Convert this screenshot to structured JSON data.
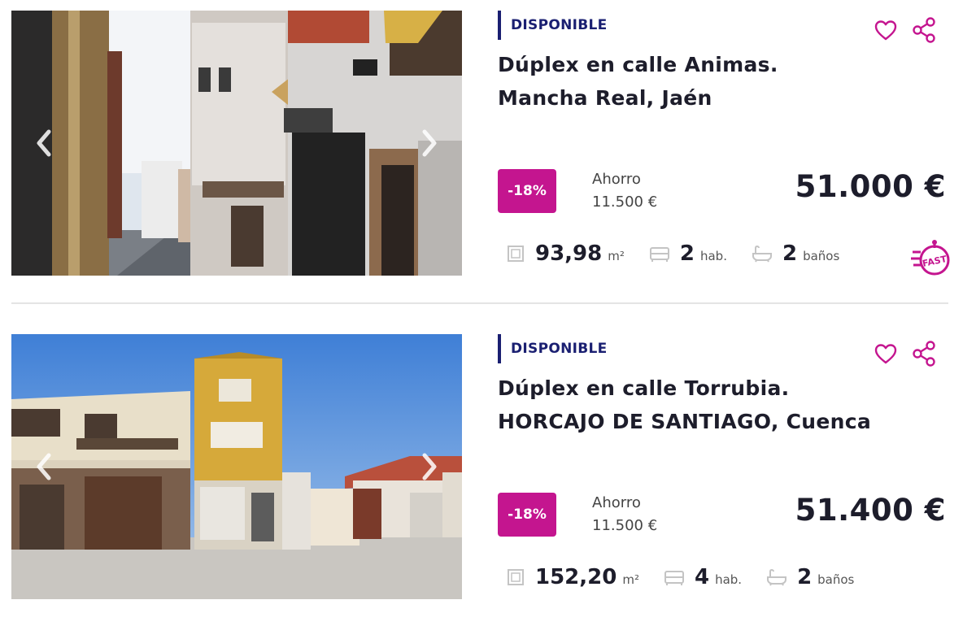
{
  "listings": [
    {
      "status": "DISPONIBLE",
      "title_line1": "Dúplex en calle Animas.",
      "title_line2": "Mancha Real, Jaén",
      "discount": "-18%",
      "savings_label": "Ahorro",
      "savings_value": "11.500 €",
      "price": "51.000 €",
      "area": "93,98",
      "area_unit": "m²",
      "rooms": "2",
      "rooms_unit": "hab.",
      "baths": "2",
      "baths_unit": "baños",
      "fast_logo": "FAST",
      "photo_icon": "street-photo"
    },
    {
      "status": "DISPONIBLE",
      "title_line1": "Dúplex en calle Torrubia.",
      "title_line2": "HORCAJO DE SANTIAGO, Cuenca",
      "discount": "-18%",
      "savings_label": "Ahorro",
      "savings_value": "11.500 €",
      "price": "51.400 €",
      "area": "152,20",
      "area_unit": "m²",
      "rooms": "4",
      "rooms_unit": "hab.",
      "baths": "2",
      "baths_unit": "baños",
      "photo_icon": "house-photo"
    }
  ],
  "colors": {
    "accent": "#c4158f",
    "status_bar": "#1a1f71",
    "text": "#1d1d2b",
    "divider": "#e4e4e4"
  },
  "icons": [
    "chevron-left-icon",
    "chevron-right-icon",
    "heart-icon",
    "share-icon",
    "area-icon",
    "bed-icon",
    "bathtub-icon"
  ]
}
